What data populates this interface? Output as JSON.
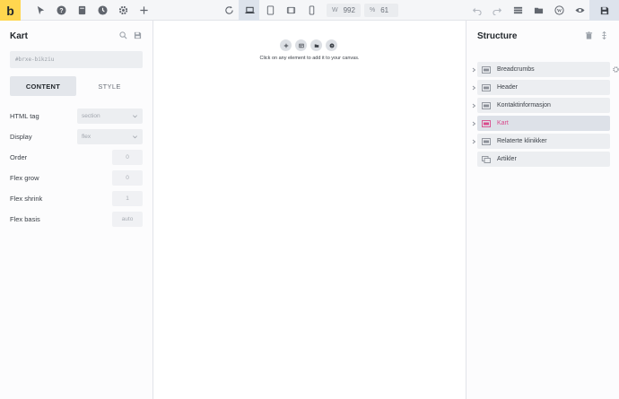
{
  "toolbar": {
    "logo": "b",
    "left_icons": [
      "cursor-icon",
      "help-icon",
      "pages-icon",
      "history-icon",
      "settings-icon",
      "add-icon"
    ],
    "center_icons": [
      "refresh-icon",
      "laptop-icon",
      "tablet-icon",
      "tablet-landscape-icon",
      "phone-icon"
    ],
    "width_label": "W",
    "width_value": "992",
    "zoom_label": "%",
    "zoom_value": "61",
    "right_icons": [
      "undo-icon",
      "redo-icon",
      "list-icon",
      "folder-icon",
      "wordpress-icon",
      "preview-icon",
      "save-icon"
    ]
  },
  "left_panel": {
    "title": "Kart",
    "id_value": "#brxe-bikziu",
    "tabs": [
      {
        "label": "CONTENT",
        "active": true
      },
      {
        "label": "STYLE",
        "active": false
      }
    ],
    "controls": [
      {
        "label": "HTML tag",
        "type": "select",
        "value": "section"
      },
      {
        "label": "Display",
        "type": "select",
        "value": "flex"
      },
      {
        "label": "Order",
        "type": "number",
        "value": "0"
      },
      {
        "label": "Flex grow",
        "type": "number",
        "value": "0"
      },
      {
        "label": "Flex shrink",
        "type": "number",
        "value": "1"
      },
      {
        "label": "Flex basis",
        "type": "number",
        "value": "auto"
      }
    ]
  },
  "canvas": {
    "buttons": [
      "add-icon",
      "template-icon",
      "folder-icon",
      "help-icon"
    ],
    "hint": "Click on any element to add it to your canvas."
  },
  "right_panel": {
    "title": "Structure",
    "items": [
      {
        "label": "Breadcrumbs",
        "active": false,
        "has_children": true
      },
      {
        "label": "Header",
        "active": false,
        "has_children": true
      },
      {
        "label": "Kontaktinformasjon",
        "active": false,
        "has_children": true
      },
      {
        "label": "Kart",
        "active": true,
        "has_children": true
      },
      {
        "label": "Relaterte klinikker",
        "active": false,
        "has_children": true
      },
      {
        "label": "Artikler",
        "active": false,
        "has_children": false
      }
    ]
  },
  "colors": {
    "accent": "#ffd64f",
    "active_item_text": "#d94a8c"
  }
}
